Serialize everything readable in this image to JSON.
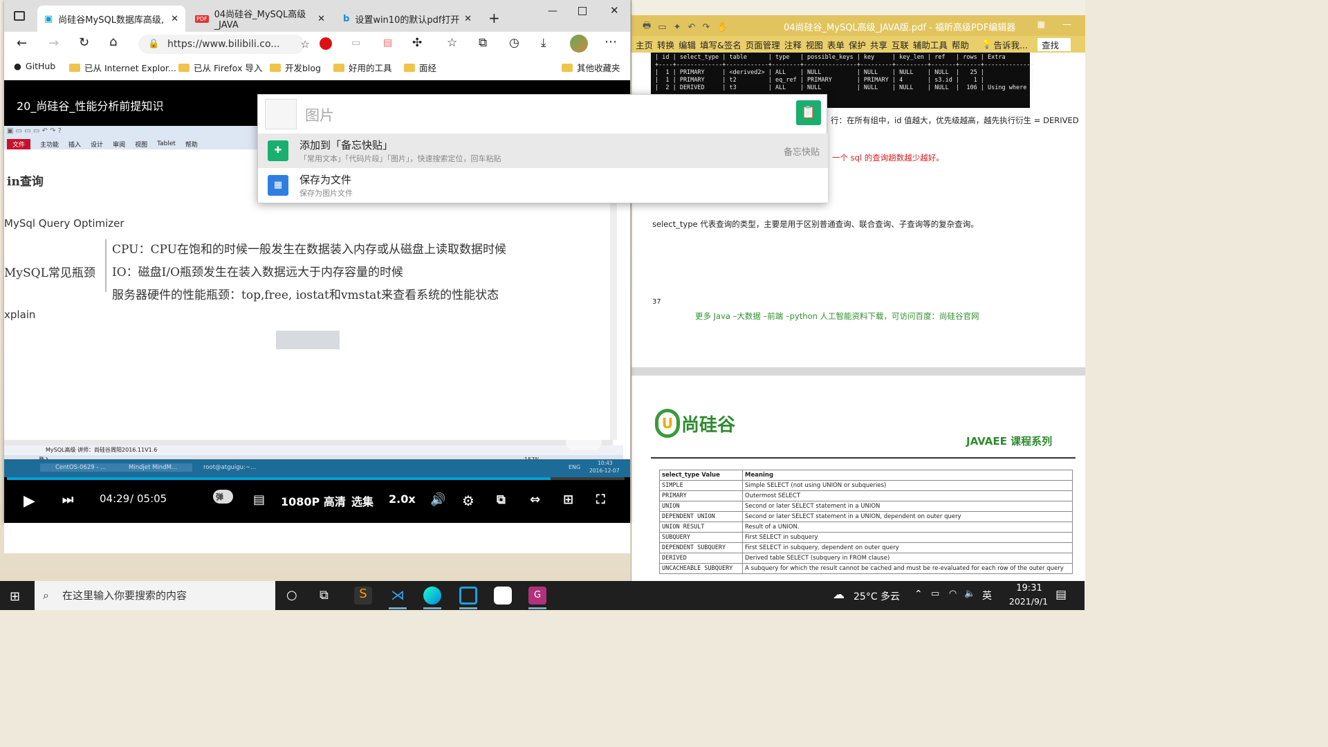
{
  "browser": {
    "tabs": [
      {
        "label": "尚硅谷MySQL数据库高级,",
        "icon": "bilibili-icon"
      },
      {
        "label": "04尚硅谷_MySQL高级_JAVA",
        "icon": "pdf-icon"
      },
      {
        "label": "设置win10的默认pdf打开",
        "icon": "bing-icon"
      }
    ],
    "address": "https://www.bilibili.co...",
    "bookmarks": [
      "GitHub",
      "已从 Internet Explor...",
      "已从 Firefox 导入",
      "开发blog",
      "好用的工具",
      "面经",
      "其他收藏夹"
    ]
  },
  "video": {
    "title": "20_尚硅谷_性能分析前提知识",
    "time_current": "04:29",
    "time_sep": "/",
    "time_total": "05:05",
    "quality": "1080P 高清",
    "episodes": "选集",
    "speed": "2.0x",
    "danmaku": "弹",
    "progress": 0.88
  },
  "mindmap": {
    "menus": [
      "文件",
      "主功能",
      "插入",
      "设计",
      "审阅",
      "视图",
      "Tablet",
      "帮助"
    ],
    "nodes": {
      "join": "in查询",
      "optimizer": "MySql Query Optimizer",
      "bottleneck": "MySQL常见瓶颈",
      "cpu": "CPU：CPU在饱和的时候一般发生在数据装入内存或从磁盘上读取数据时候",
      "io": "IO：磁盘I/O瓶颈发生在装入数据远大于内存容量的时候",
      "hw": "服务器硬件的性能瓶颈：top,free, iostat和vmstat来查看系统的性能状态",
      "explain": "xplain"
    },
    "status_tab": "MySQL高级 讲师：尚硅谷周阳2016.11V1.6",
    "login": "登入",
    "zoom": "157%",
    "vm_taskbar": [
      "CentOS-0629 - ...",
      "Mindjet MindM...",
      "root@atguigu:~..."
    ],
    "vm_lang": "ENG",
    "vm_time": "10:43",
    "vm_date": "2016-12-07"
  },
  "popup": {
    "header": "图片",
    "item1_title": "添加到「备忘快贴」",
    "item1_sub": "「常用文本」「代码片段」「图片」，快速搜索定位，回车粘贴",
    "item1_right": "备忘快贴",
    "item2_title": "保存为文件",
    "item2_sub": "保存为图片文件"
  },
  "pdf": {
    "title": "04尚硅谷_MySQL高级_JAVA版.pdf - 福昕高级PDF编辑器",
    "menu": [
      "主页",
      "转换",
      "编辑",
      "填写&签名",
      "页面管理",
      "注释",
      "视图",
      "表单",
      "保护",
      "共享",
      "互联",
      "辅助工具",
      "帮助",
      "告诉我...",
      "查找"
    ],
    "console_lines": [
      "| id | select_type | table      | type   | possible_keys | key     | key_len | ref   | rows | Extra       |",
      "+----+-------------+------------+--------+---------------+---------+---------+-------+------+-------------+",
      "|  1 | PRIMARY     | <derived2> | ALL    | NULL          | NULL    | NULL    | NULL  |   25 |             |",
      "|  1 | PRIMARY     | t2         | eq_ref | PRIMARY       | PRIMARY | 4       | s3.id |    1 |             |",
      "|  2 | DERIVED     | t3         | ALL    | NULL          | NULL    | NULL    | NULL  |  106 | Using where |"
    ],
    "text_id": "行：在所有组中，id 值越大，优先级越高，越先执行衍生 = DERIVED",
    "text_sql": "一个 sql 的查询趟数越少越好。",
    "text_select": "select_type 代表查询的类型，主要是用于区别普通查询、联合查询、子查询等的复杂查询。",
    "page_num": "37",
    "footer": "更多 Java –大数据 –前端 –python 人工智能资料下载，可访问百度：尚硅谷官网",
    "logo": "尚硅谷",
    "series": "JAVAEE 课程系列",
    "table_header": [
      "select_type Value",
      "Meaning"
    ],
    "table_rows": [
      [
        "SIMPLE",
        "Simple SELECT (not using UNION or subqueries)"
      ],
      [
        "PRIMARY",
        "Outermost SELECT"
      ],
      [
        "UNION",
        "Second or later SELECT statement in a UNION"
      ],
      [
        "DEPENDENT UNION",
        "Second or later SELECT statement in a UNION, dependent on outer query"
      ],
      [
        "UNION RESULT",
        "Result of a UNION."
      ],
      [
        "SUBQUERY",
        "First SELECT in subquery"
      ],
      [
        "DEPENDENT SUBQUERY",
        "First SELECT in subquery, dependent on outer query"
      ],
      [
        "DERIVED",
        "Derived table SELECT (subquery in FROM clause)"
      ],
      [
        "UNCACHEABLE SUBQUERY",
        "A subquery for which the result cannot be cached and must be re-evaluated for each row of the outer query"
      ]
    ]
  },
  "taskbar": {
    "search": "在这里输入你要搜索的内容",
    "weather": "25°C 多云",
    "ime": "英",
    "time": "19:31",
    "date": "2021/9/1"
  },
  "colors": {
    "accent": "#00a1d6",
    "pdf_bar": "#e2c45e",
    "popup_green": "#1aae6f"
  }
}
